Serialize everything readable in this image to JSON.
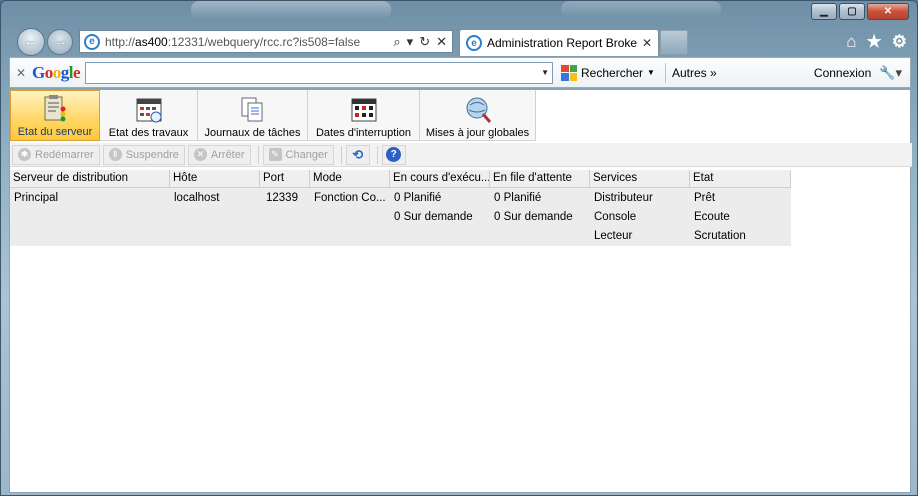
{
  "browser": {
    "address": {
      "prefix": "http://",
      "host": "as400",
      "rest": ":12331/webquery/rcc.rc?is508=false"
    },
    "tab": {
      "title": "Administration Report Broker",
      "close": "✕"
    }
  },
  "google_toolbar": {
    "logo": {
      "b1": "G",
      "o1": "o",
      "o2": "o",
      "g": "g",
      "l": "l",
      "e": "e"
    },
    "search_label": "Rechercher",
    "autres": "Autres »",
    "connexion": "Connexion"
  },
  "ribbon": {
    "buttons": [
      {
        "label": "Etat du serveur"
      },
      {
        "label": "Etat des travaux"
      },
      {
        "label": "Journaux de tâches"
      },
      {
        "label": "Dates d'interruption"
      },
      {
        "label": "Mises à jour globales"
      }
    ]
  },
  "toolbar": {
    "restart": "Redémarrer",
    "suspend": "Suspendre",
    "stop": "Arrêter",
    "change": "Changer"
  },
  "grid": {
    "columns": [
      "Serveur de distribution",
      "Hôte",
      "Port",
      "Mode",
      "En cours d'exécu...",
      "En file d'attente",
      "Services",
      "Etat"
    ],
    "row": {
      "server": "Principal",
      "host": "localhost",
      "port": "12339",
      "mode": "Fonction Co...",
      "running": [
        "0 Planifié",
        "0 Sur demande"
      ],
      "queued": [
        "0 Planifié",
        "0 Sur demande"
      ],
      "services": [
        "Distributeur",
        "Console",
        "Lecteur"
      ],
      "states": [
        "Prêt",
        "Ecoute",
        "Scrutation"
      ]
    }
  }
}
